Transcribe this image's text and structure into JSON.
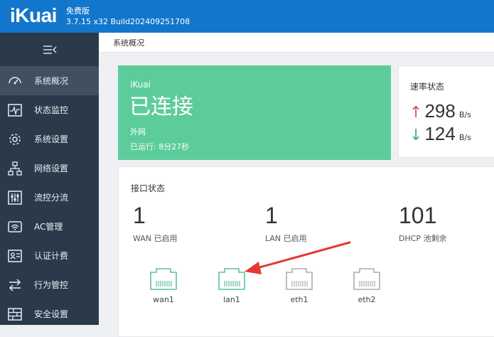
{
  "header": {
    "logo": "iKuai",
    "edition": "免费版",
    "version": "3.7.15 x32 Build202409251708"
  },
  "sidebar": {
    "collapse_icon": "collapse-menu-icon",
    "items": [
      {
        "label": "系统概况",
        "icon": "dashboard-icon",
        "active": true
      },
      {
        "label": "状态监控",
        "icon": "monitor-pulse-icon"
      },
      {
        "label": "系统设置",
        "icon": "gear-icon"
      },
      {
        "label": "网络设置",
        "icon": "network-icon"
      },
      {
        "label": "流控分流",
        "icon": "traffic-control-icon"
      },
      {
        "label": "AC管理",
        "icon": "ac-icon"
      },
      {
        "label": "认证计费",
        "icon": "auth-billing-icon"
      },
      {
        "label": "行为管控",
        "icon": "behavior-control-icon"
      },
      {
        "label": "安全设置",
        "icon": "firewall-icon"
      }
    ]
  },
  "breadcrumb": "系统概况",
  "connection": {
    "brand": "iKuai",
    "status": "已连接",
    "type": "外网",
    "uptime": "已运行: 8分27秒",
    "color": "#5dcc9b"
  },
  "rate": {
    "title": "速率状态",
    "up_value": "298",
    "up_unit": "B/s",
    "down_value": "124",
    "down_unit": "B/s",
    "up_color": "#e05555",
    "down_color": "#3fb47d"
  },
  "interfaces": {
    "title": "接口状态",
    "stats": [
      {
        "value": "1",
        "label": "WAN 已启用"
      },
      {
        "value": "1",
        "label": "LAN 已启用"
      },
      {
        "value": "101",
        "label": "DHCP 池剩余"
      }
    ],
    "ports": [
      {
        "name": "wan1",
        "state": "connected"
      },
      {
        "name": "lan1",
        "state": "connected"
      },
      {
        "name": "eth1",
        "state": "inactive"
      },
      {
        "name": "eth2",
        "state": "inactive"
      }
    ]
  },
  "colors": {
    "topbar": "#1277cc",
    "sidebar": "#2b3a4a",
    "port_active": "#5dbfa0",
    "port_inactive": "#a9adb3",
    "annotation_arrow": "#e53935"
  }
}
